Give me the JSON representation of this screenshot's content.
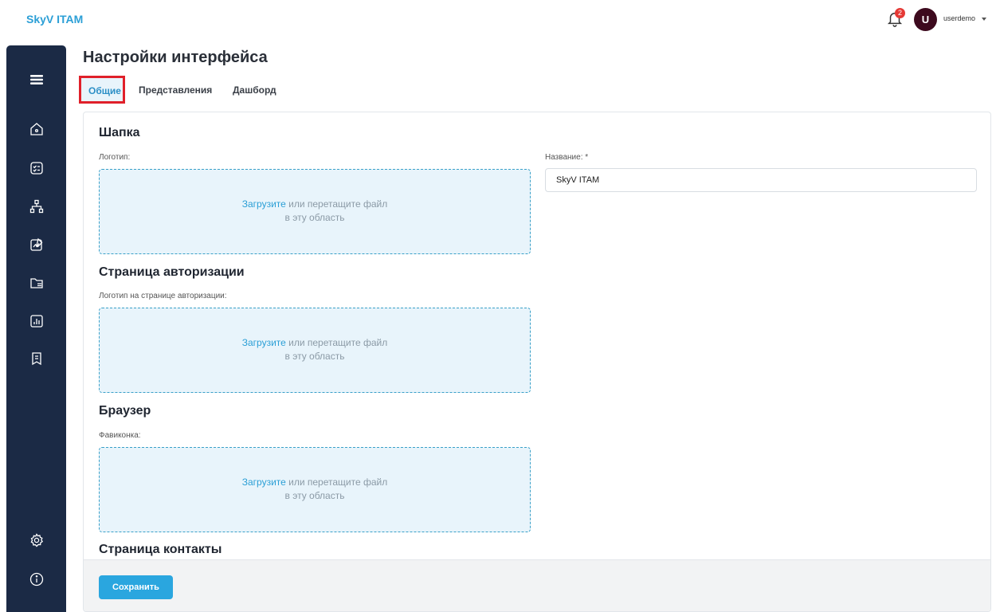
{
  "app": {
    "brand": "SkyV ITAM"
  },
  "header": {
    "notifications_count": "2",
    "avatar_letter": "U",
    "username": "userdemo"
  },
  "sidebar": {
    "icons": [
      "menu-icon",
      "home-icon",
      "checklist-icon",
      "hierarchy-icon",
      "chart-edit-icon",
      "folder-icon",
      "report-icon",
      "document-icon",
      "settings-icon",
      "info-icon"
    ]
  },
  "page": {
    "title": "Настройки интерфейса",
    "tabs": [
      {
        "label": "Общие",
        "active": true
      },
      {
        "label": "Представления",
        "active": false
      },
      {
        "label": "Дашборд",
        "active": false
      }
    ]
  },
  "form": {
    "sections": {
      "header": "Шапка",
      "auth_page": "Страница авторизации",
      "browser": "Браузер",
      "contacts": "Страница контакты"
    },
    "logo_label": "Логотип:",
    "name_label": "Название: *",
    "name_value": "SkyV ITAM",
    "auth_logo_label": "Логотип на странице авторизации:",
    "favicon_label": "Фавиконка:",
    "dropzone_link": "Загрузите",
    "dropzone_text1": " или перетащите файл",
    "dropzone_text2": "в эту область",
    "save_label": "Сохранить"
  },
  "colors": {
    "accent": "#2aa6df",
    "sidebar": "#1b2a45",
    "highlight": "#e0202a"
  }
}
